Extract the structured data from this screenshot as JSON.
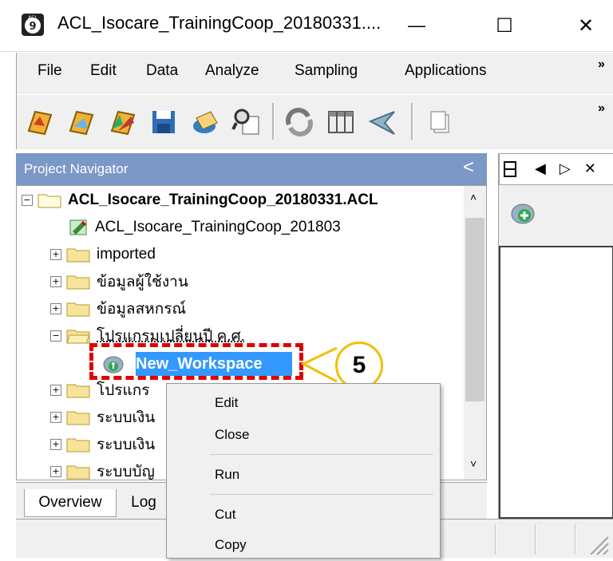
{
  "window": {
    "title": "ACL_Isocare_TrainingCoop_20180331....",
    "minimize_glyph": "—",
    "maximize_glyph": "☐",
    "close_glyph": "✕"
  },
  "menu": {
    "items": [
      "File",
      "Edit",
      "Data",
      "Analyze",
      "Sampling",
      "Applications"
    ],
    "overflow": "»"
  },
  "toolbar": {
    "overflow": "»",
    "icons": [
      "open-project-icon",
      "open-table-icon",
      "new-table-icon",
      "save-icon",
      "edit-icon",
      "find-icon",
      "refresh-icon",
      "view-icon",
      "filter-icon",
      "copy-icon"
    ]
  },
  "navigator": {
    "title": "Project Navigator",
    "collapse_glyph": "<",
    "tree": {
      "root": "ACL_Isocare_TrainingCoop_20180331.ACL",
      "log_item": "ACL_Isocare_TrainingCoop_201803",
      "folder1": "imported",
      "folder2": "ข้อมูลผู้ใช้งาน",
      "folder3": "ข้อมูลสหกรณ์",
      "folder4": "โปรแกรมเปลี่ยนปี ค.ศ.",
      "workspace": "New_Workspace",
      "folder5": "โปรแกร",
      "folder6": "ระบบเงิน",
      "folder7": "ระบบเงิน",
      "folder8": "ระบบบัญ"
    }
  },
  "callout": {
    "number": "5"
  },
  "tabs": {
    "overview": "Overview",
    "log": "Log"
  },
  "right_panel": {
    "arrows": "◀ ▷ ✕"
  },
  "context_menu": {
    "items": [
      "Edit",
      "Close",
      "Run",
      "Cut",
      "Copy"
    ]
  },
  "colors": {
    "nav_header": "#7b98c6",
    "selection": "#3399ff",
    "dash_outline": "#e00000",
    "callout_border": "#f0c000"
  }
}
